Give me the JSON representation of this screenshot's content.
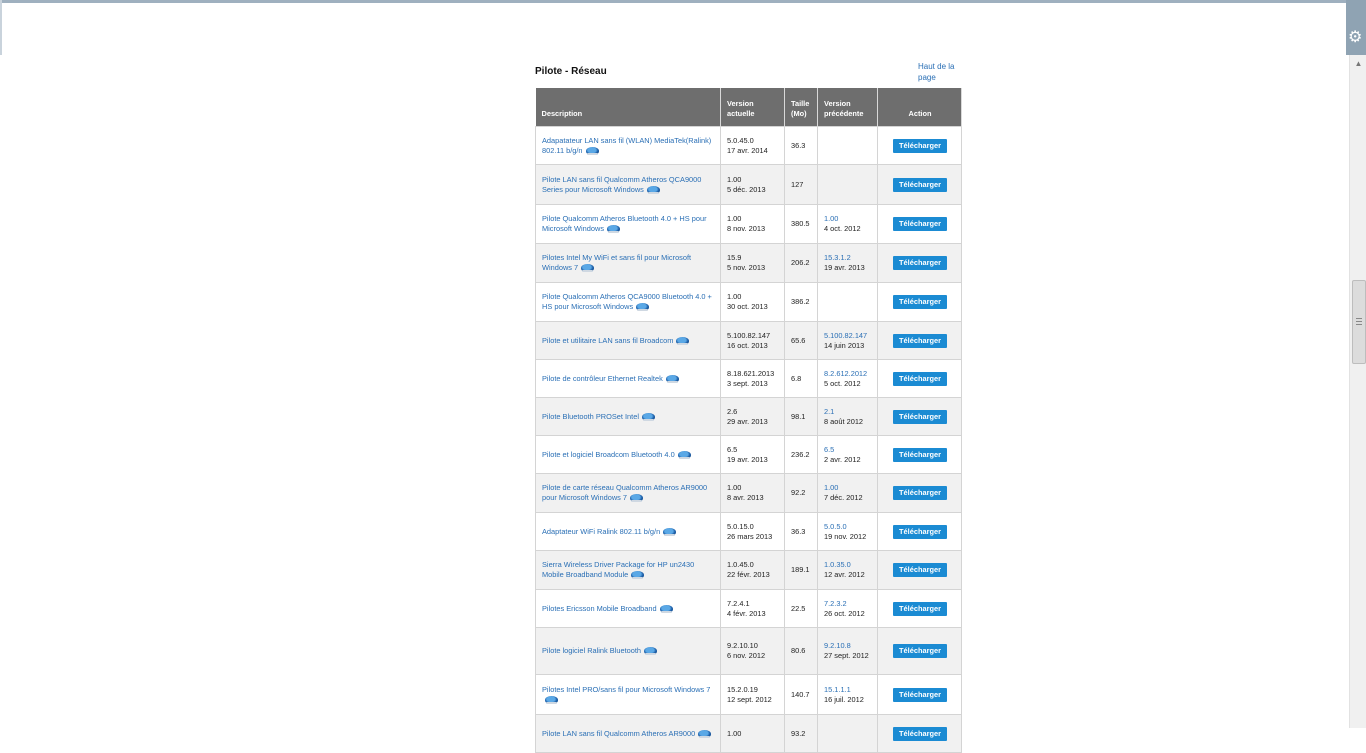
{
  "section": {
    "title": "Pilote - Réseau",
    "top_link": "Haut de la page"
  },
  "table": {
    "headers": {
      "description": "Description",
      "current_version": "Version actuelle",
      "size": "Taille (Mo)",
      "previous_version": "Version précédente",
      "action": "Action"
    },
    "button_label": "Télécharger",
    "rows": [
      {
        "description": "Adapatateur LAN sans fil (WLAN) MediaTek(Ralink) 802.11 b/g/n",
        "version": "5.0.45.0",
        "date": "17 avr. 2014",
        "size": "36.3",
        "prev_version": "",
        "prev_date": "",
        "height": 38
      },
      {
        "description": "Pilote LAN sans fil Qualcomm Atheros QCA9000 Series pour Microsoft Windows",
        "version": "1.00",
        "date": "5 déc. 2013",
        "size": "127",
        "prev_version": "",
        "prev_date": "",
        "height": 40
      },
      {
        "description": "Pilote Qualcomm Atheros Bluetooth 4.0 + HS pour Microsoft Windows",
        "version": "1.00",
        "date": "8 nov. 2013",
        "size": "380.5",
        "prev_version": "1.00",
        "prev_date": "4 oct. 2012",
        "height": 39
      },
      {
        "description": "Pilotes Intel My WiFi et sans fil pour Microsoft Windows 7",
        "version": "15.9",
        "date": "5 nov. 2013",
        "size": "206.2",
        "prev_version": "15.3.1.2",
        "prev_date": "19 avr. 2013",
        "height": 39
      },
      {
        "description": "Pilote Qualcomm Atheros QCA9000 Bluetooth 4.0 + HS pour Microsoft Windows",
        "version": "1.00",
        "date": "30 oct. 2013",
        "size": "386.2",
        "prev_version": "",
        "prev_date": "",
        "height": 39
      },
      {
        "description": "Pilote et utilitaire LAN sans fil Broadcom",
        "version": "5.100.82.147",
        "date": "16 oct. 2013",
        "size": "65.6",
        "prev_version": "5.100.82.147",
        "prev_date": "14 juin 2013",
        "height": 38
      },
      {
        "description": "Pilote de contrôleur Ethernet Realtek",
        "version": "8.18.621.2013",
        "date": "3 sept. 2013",
        "size": "6.8",
        "prev_version": "8.2.612.2012",
        "prev_date": "5 oct. 2012",
        "height": 38
      },
      {
        "description": "Pilote Bluetooth PROSet Intel",
        "version": "2.6",
        "date": "29 avr. 2013",
        "size": "98.1",
        "prev_version": "2.1",
        "prev_date": "8 août 2012",
        "height": 38
      },
      {
        "description": "Pilote et logiciel Broadcom Bluetooth 4.0",
        "version": "6.5",
        "date": "19 avr. 2013",
        "size": "236.2",
        "prev_version": "6.5",
        "prev_date": "2 avr. 2012",
        "height": 38
      },
      {
        "description": "Pilote de carte réseau Qualcomm Atheros AR9000 pour Microsoft Windows 7",
        "version": "1.00",
        "date": "8 avr. 2013",
        "size": "92.2",
        "prev_version": "1.00",
        "prev_date": "7 déc. 2012",
        "height": 39
      },
      {
        "description": "Adaptateur WiFi Ralink 802.11 b/g/n",
        "version": "5.0.15.0",
        "date": "26 mars 2013",
        "size": "36.3",
        "prev_version": "5.0.5.0",
        "prev_date": "19 nov. 2012",
        "height": 38
      },
      {
        "description": "Sierra Wireless Driver Package for HP un2430 Mobile Broadband Module",
        "version": "1.0.45.0",
        "date": "22 févr. 2013",
        "size": "189.1",
        "prev_version": "1.0.35.0",
        "prev_date": "12 avr. 2012",
        "height": 39
      },
      {
        "description": "Pilotes Ericsson Mobile Broadband",
        "version": "7.2.4.1",
        "date": "4 févr. 2013",
        "size": "22.5",
        "prev_version": "7.2.3.2",
        "prev_date": "26 oct. 2012",
        "height": 38
      },
      {
        "description": "Pilote logiciel Ralink Bluetooth",
        "version": "9.2.10.10",
        "date": "6 nov. 2012",
        "size": "80.6",
        "prev_version": "9.2.10.8",
        "prev_date": "27 sept. 2012",
        "height": 47
      },
      {
        "description": "Pilotes Intel PRO/sans fil pour Microsoft Windows 7",
        "version": "15.2.0.19",
        "date": "12 sept. 2012",
        "size": "140.7",
        "prev_version": "15.1.1.1",
        "prev_date": "16 juil. 2012",
        "height": 40
      },
      {
        "description": "Pilote LAN sans fil Qualcomm Atheros AR9000",
        "version": "1.00",
        "date": "",
        "size": "93.2",
        "prev_version": "",
        "prev_date": "",
        "height": 38
      }
    ]
  }
}
